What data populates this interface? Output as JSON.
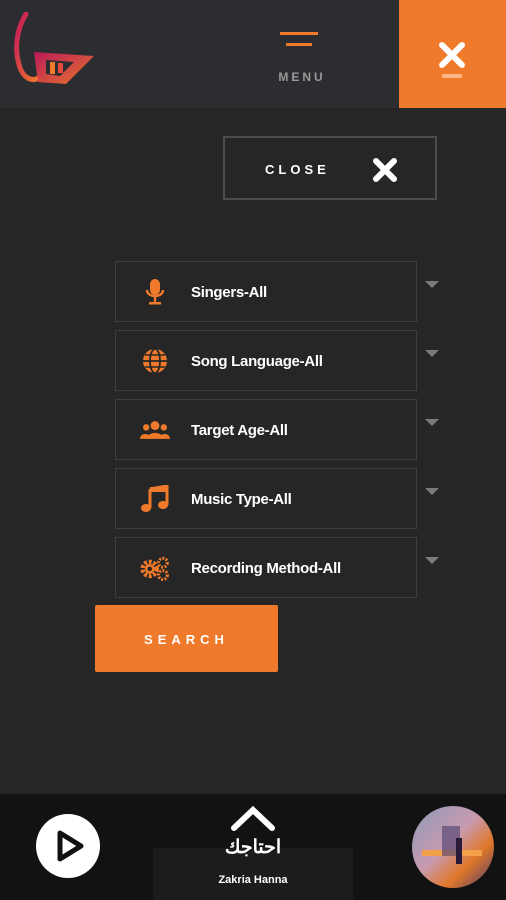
{
  "header": {
    "logo_icon": "app-logo",
    "menu_label": "MENU",
    "menu_icon": "hamburger-icon",
    "close_icon": "close-icon"
  },
  "close_panel": {
    "label": "CLOSE",
    "icon": "close-icon"
  },
  "filters": [
    {
      "label": "Singers-All",
      "icon": "microphone-icon"
    },
    {
      "label": "Song Language-All",
      "icon": "globe-icon"
    },
    {
      "label": "Target Age-All",
      "icon": "users-icon"
    },
    {
      "label": "Music Type-All",
      "icon": "music-note-icon"
    },
    {
      "label": "Recording Method-All",
      "icon": "gears-icon"
    }
  ],
  "search_label": "SEARCH",
  "player": {
    "song_title": "احتاجك",
    "artist": "Zakria Hanna",
    "play_icon": "play-icon",
    "expand_icon": "chevron-up-icon"
  },
  "colors": {
    "accent": "#f07a2b",
    "background": "#262626",
    "header": "#2c2d30",
    "player_bar": "#121212"
  }
}
